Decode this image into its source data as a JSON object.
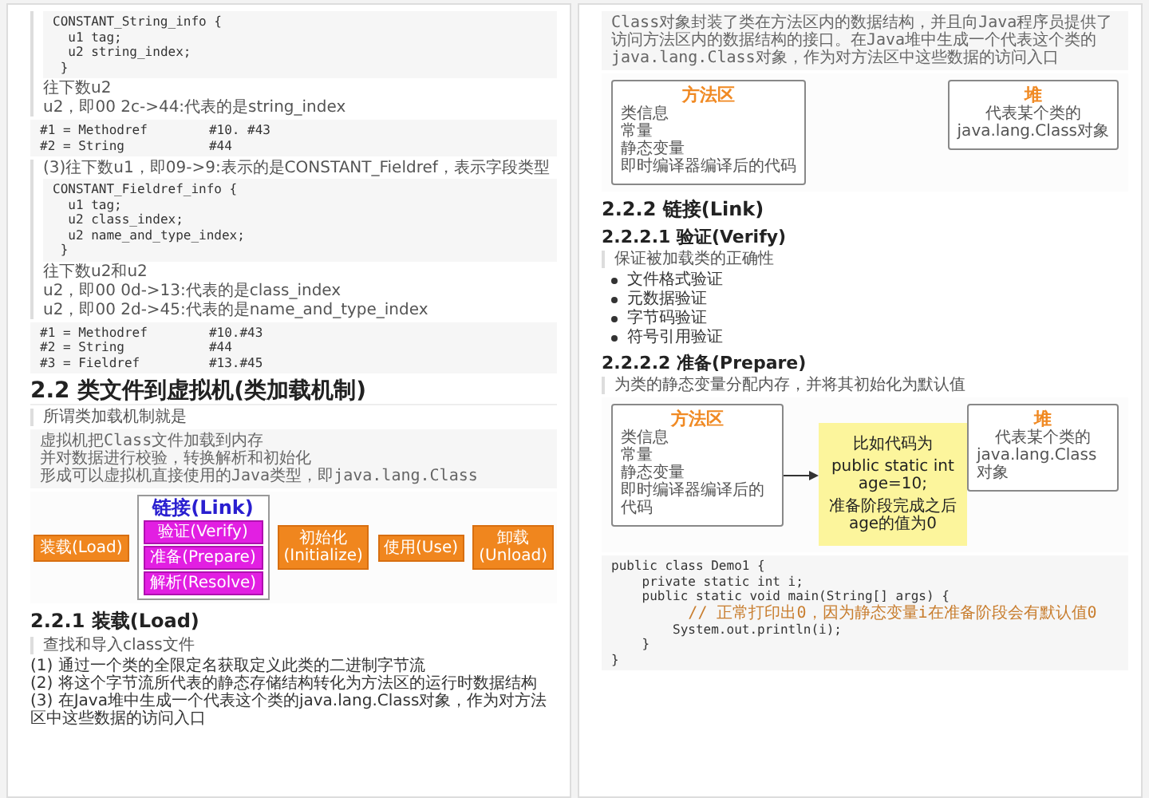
{
  "pages": [
    {
      "blocks": [
        {
          "kind": "quote",
          "children": [
            {
              "kind": "code",
              "lines": [
                "CONSTANT_String_info {",
                "  u1 tag;",
                "  u2 string_index;",
                " }"
              ]
            },
            {
              "kind": "text",
              "text": "往下数u2"
            },
            {
              "kind": "text",
              "text": "u2，即00 2c->44:代表的是string_index"
            }
          ]
        },
        {
          "kind": "code",
          "lines": [
            "#1 = Methodref        #10. #43",
            "#2 = String           #44"
          ]
        },
        {
          "kind": "quote",
          "children": [
            {
              "kind": "text",
              "text": "(3)往下数u1，即09->9:表示的是CONSTANT_Fieldref，表示字段类型"
            },
            {
              "kind": "code",
              "lines": [
                "CONSTANT_Fieldref_info {",
                "  u1 tag;",
                "  u2 class_index;",
                "  u2 name_and_type_index;",
                " }"
              ]
            },
            {
              "kind": "text",
              "text": "往下数u2和u2"
            },
            {
              "kind": "text",
              "text": "u2，即00 0d->13:代表的是class_index"
            },
            {
              "kind": "text",
              "text": "u2，即00 2d->45:代表的是name_and_type_index"
            }
          ]
        },
        {
          "kind": "code",
          "lines": [
            "#1 = Methodref        #10.#43",
            "#2 = String           #44",
            "#3 = Fieldref         #13.#45"
          ]
        },
        {
          "kind": "h2",
          "text": "2.2 类文件到虚拟机(类加载机制)"
        },
        {
          "kind": "quote",
          "children": [
            {
              "kind": "text",
              "text": "所谓类加载机制就是"
            }
          ]
        },
        {
          "kind": "code",
          "lines": [
            "虚拟机把Class文件加载到内存",
            "并对数据进行校验，转换解析和初始化",
            "形成可以虚拟机直接使用的Java类型，即java.lang.Class"
          ]
        },
        {
          "kind": "stages",
          "items": [
            {
              "kind": "stage",
              "label": "装载(Load)"
            },
            {
              "kind": "group",
              "title": "链接(Link)",
              "children": [
                "验证(Verify)",
                "准备(Prepare)",
                "解析(Resolve)"
              ]
            },
            {
              "kind": "stage",
              "label": "初始化\n(Initialize)"
            },
            {
              "kind": "stage",
              "label": "使用(Use)"
            },
            {
              "kind": "stage",
              "label": "卸载\n(Unload)"
            }
          ]
        },
        {
          "kind": "h3",
          "text": "2.2.1 装载(Load)"
        },
        {
          "kind": "quote",
          "children": [
            {
              "kind": "text",
              "text": "查找和导入class文件"
            }
          ]
        },
        {
          "kind": "list",
          "items": [
            "(1) 通过一个类的全限定名获取定义此类的二进制字节流",
            "(2) 将这个字节流所代表的静态存储结构转化为方法区的运行时数据结构",
            "(3) 在Java堆中生成一个代表这个类的java.lang.Class对象，作为对方法区中这些数据的访问入口"
          ]
        }
      ]
    },
    {
      "blocks": [
        {
          "kind": "code",
          "lines": [
            "Class对象封装了类在方法区内的数据结构，并且向Java程序员提供了访问方法区内的数据结构的接口。在Java堆中生成一个代表这个类的java.lang.Class对象，作为对方法区中这些数据的访问入口"
          ]
        },
        {
          "kind": "memory",
          "method_area": {
            "title": "方法区",
            "lines": [
              "类信息",
              "常量",
              "静态变量",
              "即时编译器编译后的代码"
            ]
          },
          "heap": {
            "title": "堆",
            "lines": [
              "代表某个类的",
              "java.lang.Class对象"
            ]
          }
        },
        {
          "kind": "h3",
          "text": "2.2.2 链接(Link)"
        },
        {
          "kind": "h4",
          "text": "2.2.2.1 验证(Verify)"
        },
        {
          "kind": "quote",
          "children": [
            {
              "kind": "text",
              "text": "保证被加载类的正确性"
            }
          ]
        },
        {
          "kind": "bullets",
          "items": [
            "文件格式验证",
            "元数据验证",
            "字节码验证",
            "符号引用验证"
          ]
        },
        {
          "kind": "h4",
          "text": "2.2.2.2 准备(Prepare)"
        },
        {
          "kind": "quote",
          "children": [
            {
              "kind": "text",
              "text": "为类的静态变量分配内存，并将其初始化为默认值"
            }
          ]
        },
        {
          "kind": "memory",
          "method_area": {
            "title": "方法区",
            "lines": [
              "类信息",
              "常量",
              "静态变量",
              "即时编译器编译后的代码"
            ]
          },
          "note": {
            "lines": [
              "比如代码为",
              "public static int age=10;",
              "准备阶段完成之后age的值为0"
            ]
          },
          "heap": {
            "title": "堆",
            "lines": [
              "代表某个类的",
              "java.lang.Class对象"
            ]
          }
        },
        {
          "kind": "code",
          "lines": [
            "public class Demo1 {",
            "    private static int i;",
            "    public static void main(String[] args) {",
            "        // 正常打印出0，因为静态变量i在准备阶段会有默认值0",
            "        System.out.println(i);",
            "    }",
            "}"
          ]
        }
      ]
    }
  ]
}
